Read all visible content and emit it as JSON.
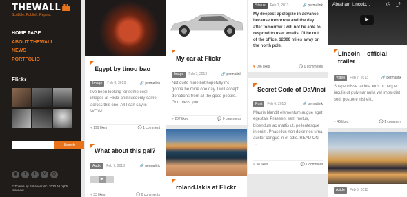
{
  "sidebar": {
    "logo": "THEWALL",
    "tagline": "Scribble. Publish. Repeat.",
    "nav": [
      "HOME PAGE",
      "ABOUT THEWALL",
      "NEWS",
      "PORTFOLIO"
    ],
    "flickr_title": "Flickr",
    "search_placeholder": "",
    "search_button": "Search",
    "social_icons": [
      "rss-icon",
      "facebook-icon",
      "twitter-icon",
      "vimeo-icon",
      "dribbble-icon"
    ],
    "copyright": "© Theme by Sollaricer inc. 2020 All rights reserved."
  },
  "col1": {
    "card1_title": "Egypt by tinou bao",
    "card1_tag": "Image",
    "card1_date": "Feb 8, 2013",
    "card1_perma": "permalink",
    "card1_body": "I've been looking for some cool images at Flickr and suddenly came across this one. All I can say is WOW!",
    "card1_likes": "199 likes",
    "card1_comments": "1 comment",
    "card2_title": "What about this gal?",
    "card2_tag": "Audio",
    "card2_date": "Feb 7, 2013",
    "card2_perma": "permalink",
    "card2_likes": "33 likes",
    "card2_comments": "0 comments"
  },
  "col2": {
    "card1_title": "My car at Flickr",
    "card1_tag": "Image",
    "card1_date": "Feb 7, 2013",
    "card1_perma": "permalink",
    "card1_body": "Not quite mine but hopefully it's gonna be mine one day. I will accept donations from all the good people. God bless you!",
    "card1_likes": "207 likes",
    "card1_comments": "0 comments",
    "card2_title": "roland.lakis at Flickr"
  },
  "col3": {
    "card1_tag": "Status",
    "card1_date": "Feb 7, 2013",
    "card1_perma": "permalink",
    "card1_body": "My deepest apologize in advance because tomorrow and the day after tomorrow I will not be able to respond to user emails. I'll be out of the office, 12000 miles away on the north pole.",
    "card1_likes": "106 likes",
    "card1_comments": "0 comments",
    "card2_title": "Secret Code of DaVinci",
    "card2_tag": "Post",
    "card2_date": "Feb 6, 2013",
    "card2_perma": "permalink",
    "card2_body": "Mauris blandit elementum augue eget egestas. Praesent sem metus, bibendum ac mattis ut, pellentesque in enim. Phasellus non dolor nec urna auctor congue in et odio. READ ON →",
    "card2_likes": "38 likes",
    "card2_comments": "1 comment"
  },
  "col4": {
    "video_title": "Abraham Lincolo...",
    "card1_title": "Lincoln – official trailer",
    "card1_tag": "Video",
    "card1_date": "Feb 7, 2013",
    "card1_perma": "permalink",
    "card1_body": "Suspendisse lacinia eros ut neque iaculis ut pulvinar nulla vel imperdiet sed, posuere nisi elit.",
    "card1_likes": "46 likes",
    "card1_comments": "1 comment",
    "card2_tag": "Aside",
    "card2_date": "Feb 5, 2013"
  }
}
